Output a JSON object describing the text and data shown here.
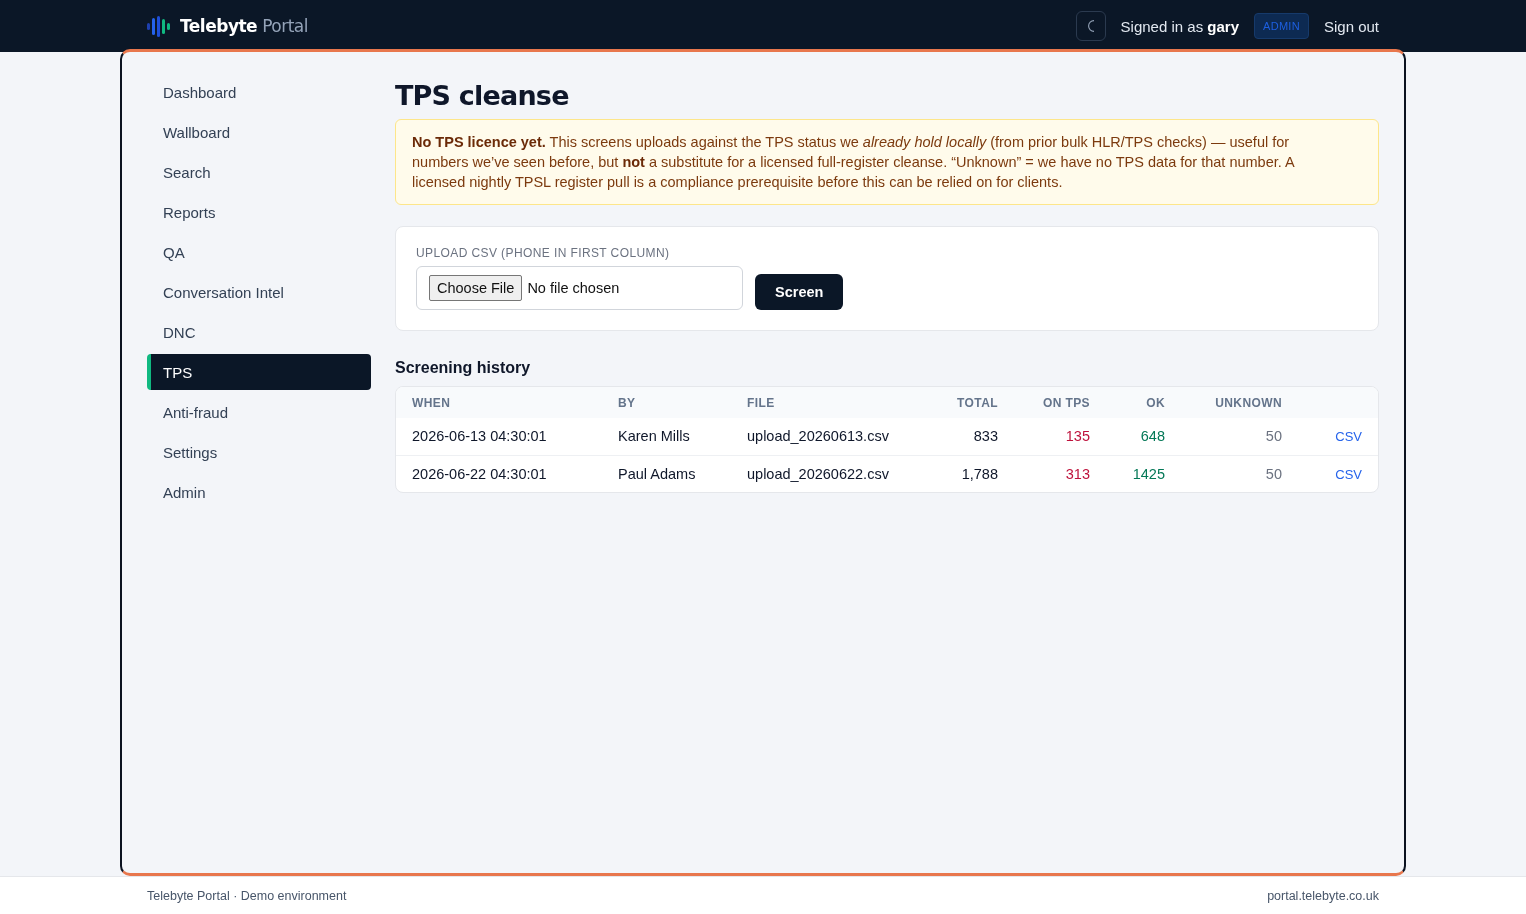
{
  "header": {
    "brand": {
      "name": "Telebyte",
      "suffix": "Portal"
    },
    "user": "Signed in as **gary**",
    "role_badge": "ADMIN",
    "sign_out": "Sign out"
  },
  "sidebar": {
    "items": [
      {
        "label": "Dashboard",
        "selected": false
      },
      {
        "label": "Wallboard",
        "selected": false
      },
      {
        "label": "Search",
        "selected": false
      },
      {
        "label": "Reports",
        "selected": false
      },
      {
        "label": "QA",
        "selected": false
      },
      {
        "label": "Conversation Intel",
        "selected": false
      },
      {
        "label": "DNC",
        "selected": false
      },
      {
        "label": "TPS",
        "selected": true
      },
      {
        "label": "Anti-fraud",
        "selected": false
      },
      {
        "label": "Settings",
        "selected": false
      },
      {
        "label": "Admin",
        "selected": false
      }
    ]
  },
  "page": {
    "title": "TPS cleanse"
  },
  "alert": {
    "text": "**No TPS licence yet.** This screens uploads against the TPS status we *already hold locally* (from prior bulk HLR/TPS checks) — useful for numbers we’ve seen before, but **not** a substitute for a licensed full-register cleanse. “Unknown” = we have no TPS data for that number. A licensed nightly TPSL register pull is a compliance prerequisite before this can be relied on for clients."
  },
  "upload": {
    "label": "UPLOAD CSV (PHONE IN FIRST COLUMN)",
    "file_button": "Choose File",
    "file_status": "No file chosen",
    "submit": "Screen"
  },
  "history": {
    "title": "Screening history",
    "columns": [
      "WHEN",
      "BY",
      "FILE",
      "TOTAL",
      "ON TPS",
      "OK",
      "UNKNOWN"
    ],
    "rows": [
      {
        "when": "2026-06-13 04:30:01",
        "by": "Karen Mills",
        "file": "upload_20260613.csv",
        "total": "833",
        "on_tps": "135",
        "ok": "648",
        "unknown": "50",
        "download": "CSV"
      },
      {
        "when": "2026-06-22 04:30:01",
        "by": "Paul Adams",
        "file": "upload_20260622.csv",
        "total": "1,788",
        "on_tps": "313",
        "ok": "1425",
        "unknown": "50",
        "download": "CSV"
      }
    ]
  },
  "footer": {
    "left": "Telebyte Portal · Demo environment",
    "right": "portal.telebyte.co.uk"
  }
}
